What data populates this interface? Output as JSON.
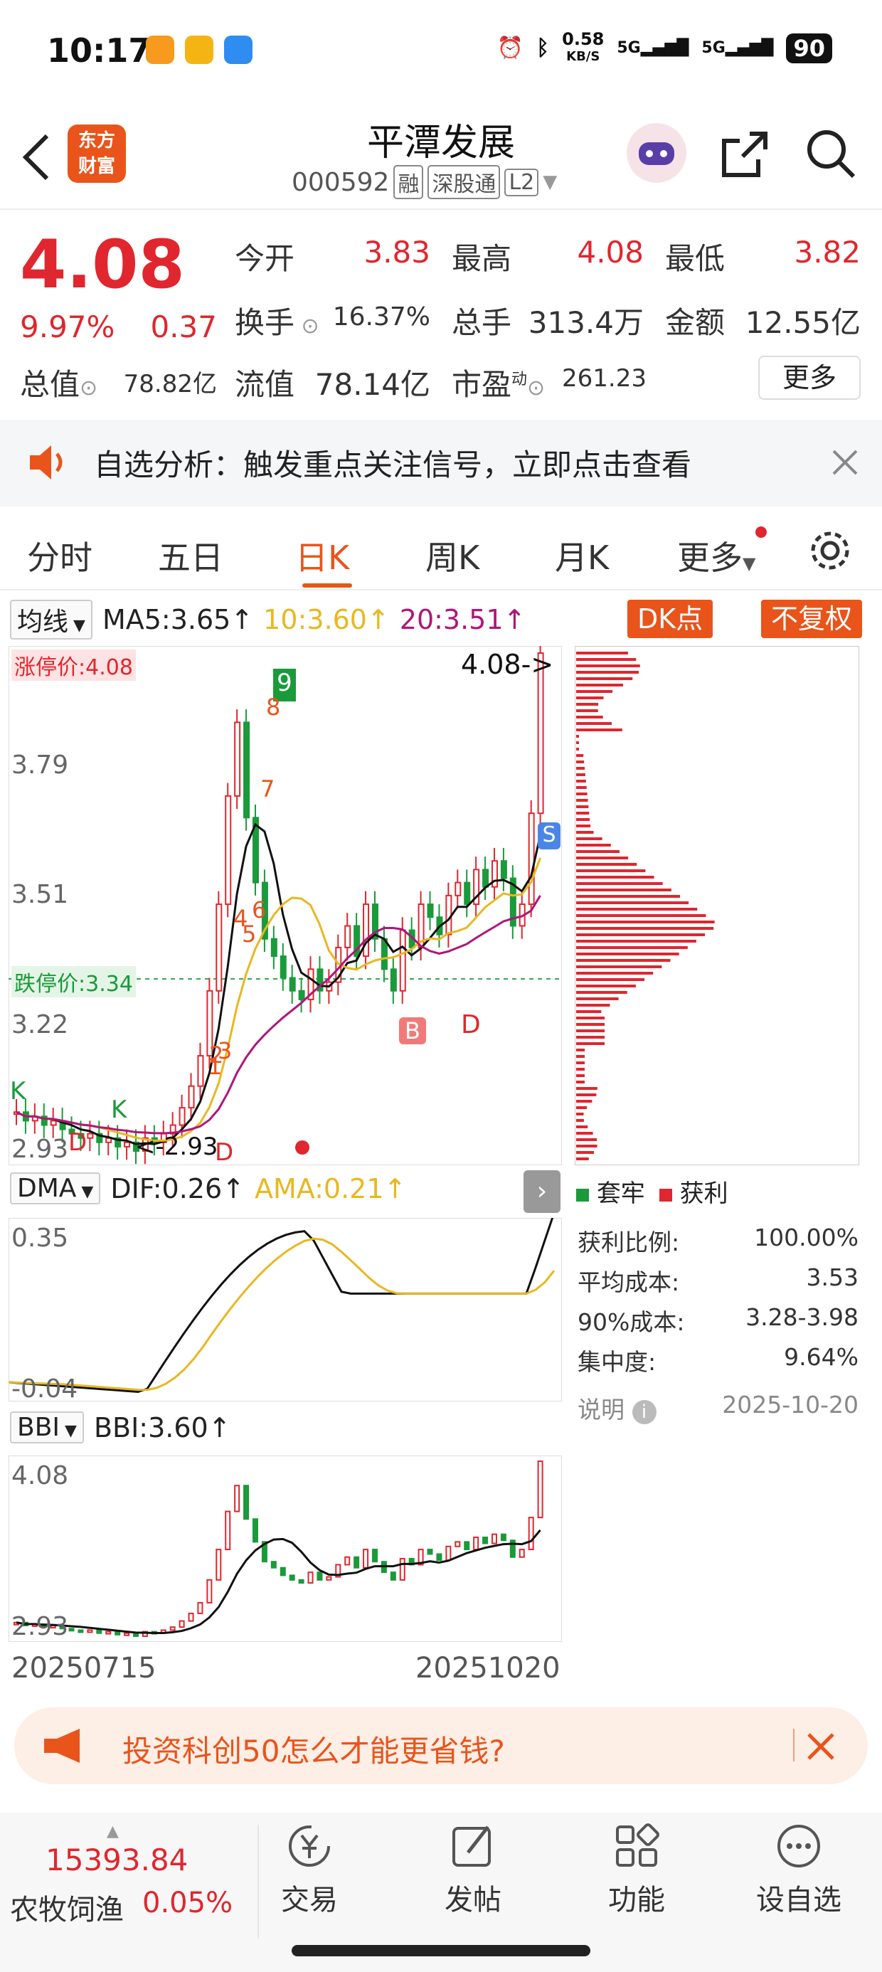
{
  "status_bar": {
    "time": "10:17",
    "net_speed": "0.58",
    "net_unit": "KB/S",
    "signal1": "5G",
    "signal2": "5G",
    "battery": "90"
  },
  "header": {
    "logo_line1": "东方",
    "logo_line2": "财富",
    "title": "平潭发展",
    "code": "000592",
    "tag_margin": "融",
    "tag_connect": "深股通",
    "tag_level": "L2"
  },
  "quote": {
    "price": "4.08",
    "change_pct": "9.97%",
    "change": "0.37",
    "open_label": "今开",
    "open": "3.83",
    "high_label": "最高",
    "high": "4.08",
    "low_label": "最低",
    "low": "3.82",
    "turnover_label": "换手",
    "turnover": "16.37%",
    "volume_label": "总手",
    "volume": "313.4万",
    "amount_label": "金额",
    "amount": "12.55亿",
    "mcap_label": "总值",
    "mcap": "78.82亿",
    "float_label": "流值",
    "float_cap": "78.14亿",
    "pe_label": "市盈",
    "pe_sup": "动",
    "pe": "261.23",
    "more_label": "更多"
  },
  "banner": {
    "text": "自选分析：触发重点关注信号，立即点击查看"
  },
  "tabs": [
    {
      "label": "分时"
    },
    {
      "label": "五日"
    },
    {
      "label": "日K"
    },
    {
      "label": "周K"
    },
    {
      "label": "月K"
    },
    {
      "label": "更多"
    }
  ],
  "ma_legend": {
    "selector": "均线",
    "ma5": "MA5:3.65↑",
    "ma10": "10:3.60↑",
    "ma20": "20:3.51↑",
    "dk_btn": "DK点",
    "adj_btn": "不复权"
  },
  "kline": {
    "limit_up": "涨停价:4.08",
    "limit_down": "跌停价:3.34",
    "y_labels": [
      "3.79",
      "3.51",
      "3.22",
      "2.93"
    ],
    "y_top": "4.08",
    "high_tag": "4.08->",
    "low_tag": "<-2.93",
    "markers": [
      "9",
      "8",
      "7",
      "6",
      "5",
      "4",
      "3",
      "2",
      "1",
      "B",
      "D",
      "S",
      "K",
      "K",
      "D",
      "D"
    ]
  },
  "chip": {
    "legend_trap": "套牢",
    "legend_profit": "获利",
    "rows": [
      {
        "label": "获利比例:",
        "value": "100.00%"
      },
      {
        "label": "平均成本:",
        "value": "3.53"
      },
      {
        "label": "90%成本:",
        "value": "3.28-3.98"
      },
      {
        "label": "集中度:",
        "value": "9.64%"
      }
    ],
    "note_label": "说明",
    "date": "2025-10-20"
  },
  "dma": {
    "selector": "DMA",
    "dif": "DIF:0.26↑",
    "ama": "AMA:0.21↑",
    "y_top": "0.35",
    "y_bottom": "-0.04"
  },
  "bbi": {
    "selector": "BBI",
    "value": "BBI:3.60↑",
    "y_top": "4.08",
    "y_bottom": "2.93",
    "date_start": "20250715",
    "date_end": "20251020"
  },
  "ad": {
    "text": "投资科创50怎么才能更省钱?"
  },
  "bottom": {
    "index_value": "15393.84",
    "index_name": "农牧饲渔",
    "index_change": "0.05%",
    "nav": [
      {
        "label": "交易"
      },
      {
        "label": "发帖"
      },
      {
        "label": "功能"
      },
      {
        "label": "设自选"
      }
    ]
  },
  "colors": {
    "up": "#e0262e",
    "down": "#1a9a3a",
    "accent": "#e9541b",
    "ma10": "#e8b820",
    "ma20": "#b0157a"
  }
}
